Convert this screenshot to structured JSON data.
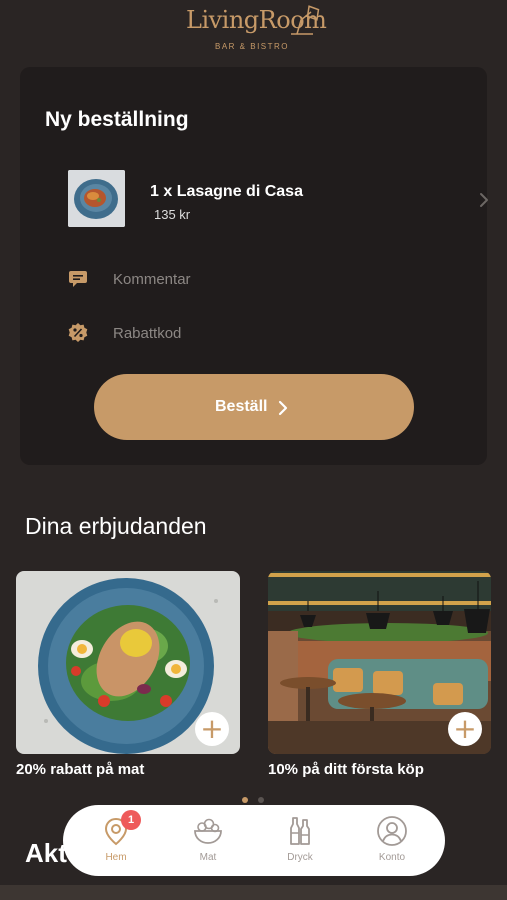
{
  "brand": {
    "name": "LivingRoom",
    "subtitle": "BAR & BISTRO"
  },
  "order": {
    "title": "Ny beställning",
    "item": {
      "name": "1 x Lasagne di Casa",
      "price": "135 kr"
    },
    "comment_placeholder": "Kommentar",
    "discount_placeholder": "Rabattkod",
    "submit_label": "Beställ"
  },
  "offers": {
    "heading": "Dina erbjudanden",
    "items": [
      {
        "label": "20% rabatt på mat"
      },
      {
        "label": "10% på ditt första köp"
      }
    ]
  },
  "next_section": {
    "heading_partial": "Akt"
  },
  "tabbar": {
    "items": [
      {
        "label": "Hem",
        "icon": "location-pin-icon",
        "badge": "1",
        "active": true
      },
      {
        "label": "Mat",
        "icon": "salad-bowl-icon",
        "active": false
      },
      {
        "label": "Dryck",
        "icon": "bottles-icon",
        "active": false
      },
      {
        "label": "Konto",
        "icon": "user-icon",
        "active": false
      }
    ]
  },
  "colors": {
    "background": "#2a2524",
    "card": "#201c1c",
    "accent": "#c79a68",
    "badge": "#ee5a5a",
    "tabbar": "#ffffff"
  }
}
